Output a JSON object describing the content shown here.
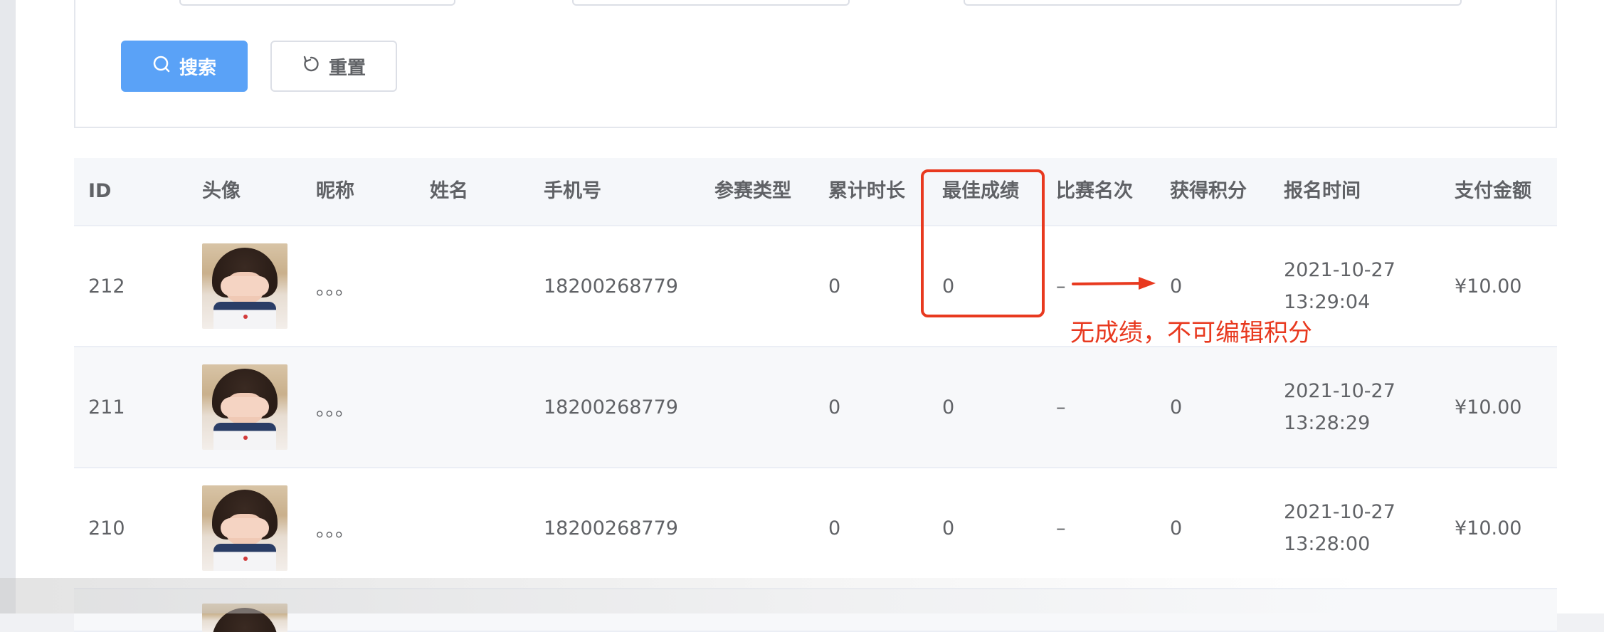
{
  "search": {
    "search_label": "搜索",
    "reset_label": "重置"
  },
  "table": {
    "headers": [
      "ID",
      "头像",
      "昵称",
      "姓名",
      "手机号",
      "参赛类型",
      "累计时长",
      "最佳成绩",
      "比赛名次",
      "获得积分",
      "报名时间",
      "支付金额"
    ],
    "rows": [
      {
        "id": "212",
        "nickname": "。。。",
        "name": "",
        "phone": "18200268779",
        "type": "",
        "duration": "0",
        "best": "0",
        "rank": "–",
        "points": "0",
        "date": "2021-10-27",
        "time": "13:29:04",
        "amount": "¥10.00"
      },
      {
        "id": "211",
        "nickname": "。。。",
        "name": "",
        "phone": "18200268779",
        "type": "",
        "duration": "0",
        "best": "0",
        "rank": "–",
        "points": "0",
        "date": "2021-10-27",
        "time": "13:28:29",
        "amount": "¥10.00"
      },
      {
        "id": "210",
        "nickname": "。。。",
        "name": "",
        "phone": "18200268779",
        "type": "",
        "duration": "0",
        "best": "0",
        "rank": "–",
        "points": "0",
        "date": "2021-10-27",
        "time": "13:28:00",
        "amount": "¥10.00"
      }
    ]
  },
  "annotation": {
    "text": "无成绩，不可编辑积分",
    "color": "#e8391f"
  },
  "icons": {
    "search": "search-icon",
    "reset": "refresh-icon"
  }
}
